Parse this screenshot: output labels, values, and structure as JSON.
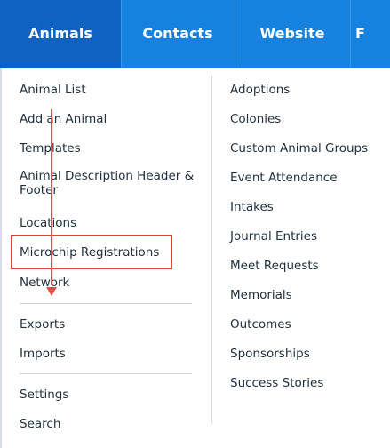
{
  "nav": {
    "tabs": [
      {
        "label": "Animals",
        "active": true
      },
      {
        "label": "Contacts",
        "active": false
      },
      {
        "label": "Website",
        "active": false
      },
      {
        "label": "F",
        "active": false
      }
    ]
  },
  "menu": {
    "left": {
      "group1": [
        "Animal List",
        "Add an Animal",
        "Templates",
        "Animal Description Header & Footer",
        "Locations",
        "Microchip Registrations",
        "Network"
      ],
      "group2": [
        "Exports",
        "Imports"
      ],
      "group3": [
        "Settings",
        "Search"
      ]
    },
    "right": [
      "Adoptions",
      "Colonies",
      "Custom Animal Groups",
      "Event Attendance",
      "Intakes",
      "Journal Entries",
      "Meet Requests",
      "Memorials",
      "Outcomes",
      "Sponsorships",
      "Success Stories"
    ],
    "highlighted_item": "Microchip Registrations"
  },
  "colors": {
    "nav_active": "#0f62c2",
    "nav_bg": "#1681df",
    "annotation": "#e54b4b",
    "text": "#1f2f3d"
  }
}
